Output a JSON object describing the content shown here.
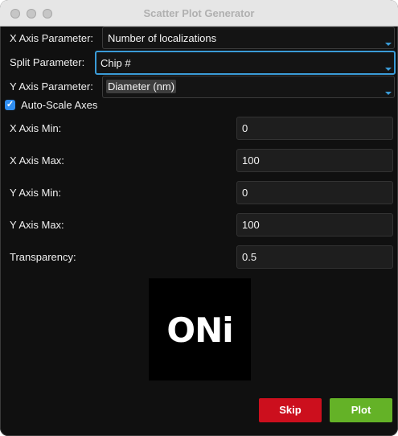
{
  "window": {
    "title": "Scatter Plot Generator"
  },
  "form": {
    "x_axis_param": {
      "label": "X Axis Parameter:",
      "value": "Number of localizations"
    },
    "split_param": {
      "label": "Split Parameter:",
      "value": "Chip #"
    },
    "y_axis_param": {
      "label": "Y Axis Parameter:",
      "value": "Diameter (nm)"
    },
    "auto_scale": {
      "label": "Auto-Scale Axes",
      "checked": true,
      "check_glyph": "✓"
    },
    "x_min": {
      "label": "X Axis Min:",
      "value": "0"
    },
    "x_max": {
      "label": "X Axis Max:",
      "value": "100"
    },
    "y_min": {
      "label": "Y Axis Min:",
      "value": "0"
    },
    "y_max": {
      "label": "Y Axis Max:",
      "value": "100"
    },
    "transparency": {
      "label": "Transparency:",
      "value": "0.5"
    }
  },
  "logo": {
    "text": "ONi"
  },
  "buttons": {
    "skip": "Skip",
    "plot": "Plot"
  },
  "colors": {
    "accent": "#3a9bd7",
    "skip": "#cc0f1d",
    "plot": "#64b227",
    "background": "#101010"
  }
}
